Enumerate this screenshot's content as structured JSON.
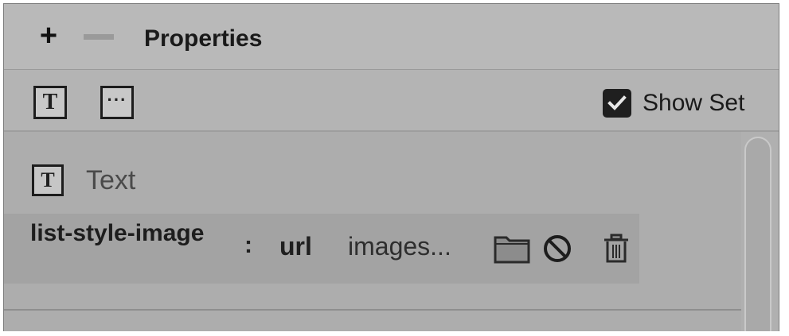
{
  "header": {
    "add_label": "+",
    "title": "Properties"
  },
  "toolbar": {
    "text_icon_glyph": "T",
    "more_icon_glyph": "···",
    "show_set_label": "Show Set",
    "show_set_checked": true
  },
  "section": {
    "icon_glyph": "T",
    "label": "Text"
  },
  "property": {
    "name": "list-style-image",
    "colon": ":",
    "type": "url",
    "value": "images..."
  },
  "icons": [
    "add-icon",
    "remove-icon",
    "text-properties-icon",
    "more-icon",
    "checkbox-icon",
    "folder-icon",
    "none-icon",
    "trash-icon"
  ]
}
